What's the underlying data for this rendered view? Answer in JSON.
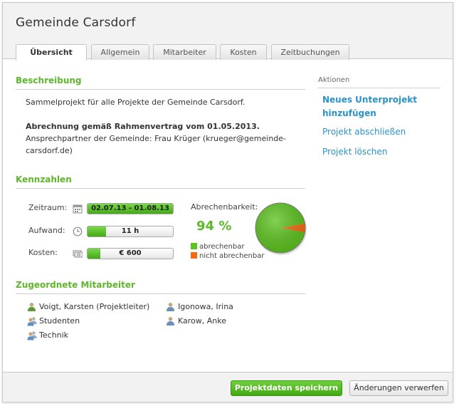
{
  "window": {
    "title": "Gemeinde Carsdorf"
  },
  "tabs": [
    {
      "label": "Übersicht",
      "active": true
    },
    {
      "label": "Allgemein",
      "active": false
    },
    {
      "label": "Mitarbeiter",
      "active": false
    },
    {
      "label": "Kosten",
      "active": false
    },
    {
      "label": "Zeitbuchungen",
      "active": false
    }
  ],
  "beschreibung": {
    "title": "Beschreibung",
    "line1": "Sammelprojekt für alle Projekte der Gemeinde Carsdorf.",
    "bold_line": "Abrechnung gemäß Rahmenvertrag vom 01.05.2013.",
    "line3": "Ansprechpartner der Gemeinde: Frau Krüger (krueger@gemeinde-",
    "line4": "carsdorf.de)"
  },
  "aktionen": {
    "title": "Aktionen",
    "items": [
      {
        "label_line1": "Neues Unterprojekt",
        "label_line2": "hinzufügen"
      },
      {
        "label": "Projekt abschließen"
      },
      {
        "label": "Projekt löschen"
      }
    ]
  },
  "kennzahlen": {
    "title": "Kennzahlen",
    "zeitraum": {
      "label": "Zeitraum:",
      "value": "02.07.13 - 01.08.13",
      "fill_fraction": 1.0,
      "icon": "calendar-icon"
    },
    "aufwand": {
      "label": "Aufwand:",
      "value": "11 h",
      "fill_fraction": 0.22,
      "icon": "clock-icon"
    },
    "kosten": {
      "label": "Kosten:",
      "value": "€ 600",
      "fill_fraction": 0.15,
      "icon": "money-icon"
    },
    "abrechenbarkeit": {
      "label": "Abrechenbarkeit:",
      "percent_text": "94 %",
      "legend": [
        {
          "label": "abrechenbar",
          "color": "#5cc21e"
        },
        {
          "label": "nicht abrechenbar",
          "color": "#f26b0f"
        }
      ]
    }
  },
  "chart_data": {
    "type": "pie",
    "categories": [
      "abrechenbar",
      "nicht abrechenbar"
    ],
    "values": [
      94,
      6
    ],
    "colors": [
      "#5cc21e",
      "#f26b0f"
    ]
  },
  "mitarbeiter": {
    "title": "Zugeordnete Mitarbeiter",
    "left": [
      {
        "label": "Voigt, Karsten (Projektleiter)",
        "icon": "user-icon"
      },
      {
        "label": "Studenten",
        "icon": "group-icon"
      },
      {
        "label": "Technik",
        "icon": "group-icon"
      }
    ],
    "right": [
      {
        "label": "Igonowa, Irina",
        "icon": "user-icon"
      },
      {
        "label": "Karow, Anke",
        "icon": "user-icon"
      }
    ]
  },
  "footer": {
    "save_label": "Projektdaten speichern",
    "discard_label": "Änderungen verwerfen"
  }
}
